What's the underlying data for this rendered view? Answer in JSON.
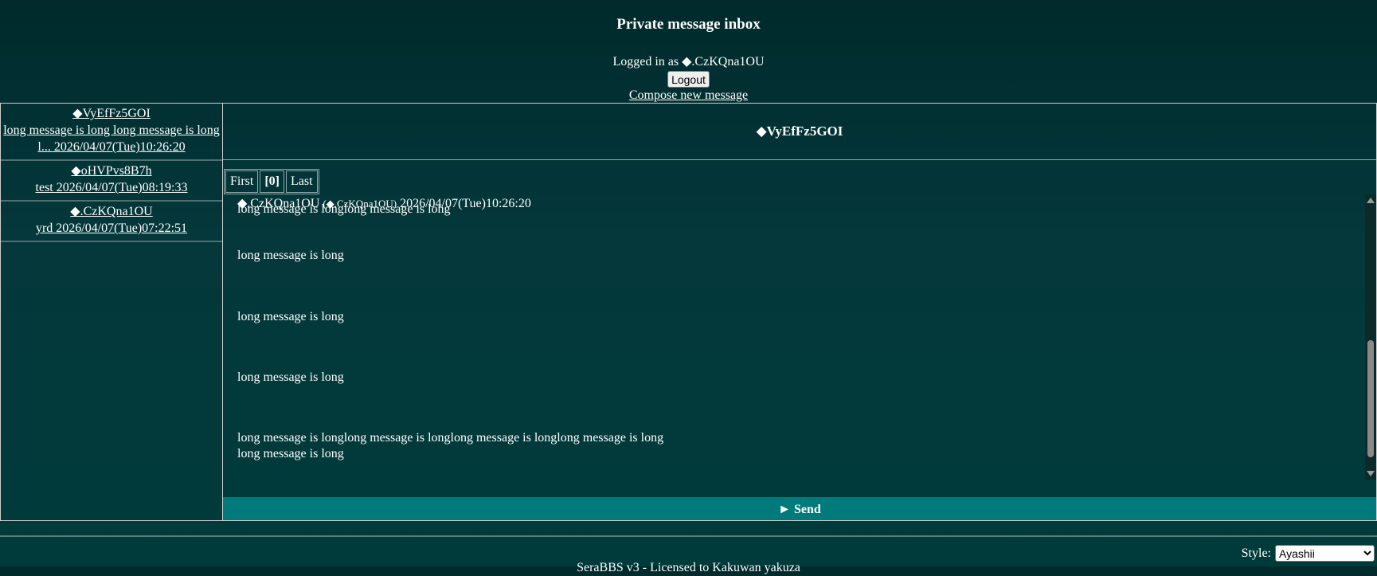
{
  "page": {
    "title": "Private message inbox",
    "logged_in_prefix": "Logged in as ",
    "user_name": "◆.CzKQna1OU",
    "logout_label": "Logout",
    "compose_label": "Compose new message"
  },
  "threads": [
    {
      "name": "◆VyEfFz5GOI",
      "preview": "long message is long long message is long l... 2026/04/07(Tue)10:26:20"
    },
    {
      "name": "◆oHVPvs8B7h",
      "preview": "test 2026/04/07(Tue)08:19:33"
    },
    {
      "name": "◆.CzKQna1OU",
      "preview": "yrd 2026/04/07(Tue)07:22:51"
    }
  ],
  "conversation": {
    "title": "◆VyEfFz5GOI",
    "pager": {
      "first": "First",
      "current": "[0]",
      "last": "Last"
    },
    "message_author": "◆.CzKQna1OU",
    "message_author_tag": "(◆.CzKQna1OU)",
    "message_time": "2026/04/07(Tue)10:26:20",
    "lines": [
      "long message is longlong message is long",
      "long message is long",
      "long message is long",
      "long message is long",
      "long message is longlong message is longlong message is longlong message is long",
      "long message is long"
    ],
    "send_label": "► Send"
  },
  "footer": {
    "style_label": "Style:",
    "style_value": "Ayashii",
    "credit": "SeraBBS v3 - Licensed to Kakuwan yakuza"
  }
}
